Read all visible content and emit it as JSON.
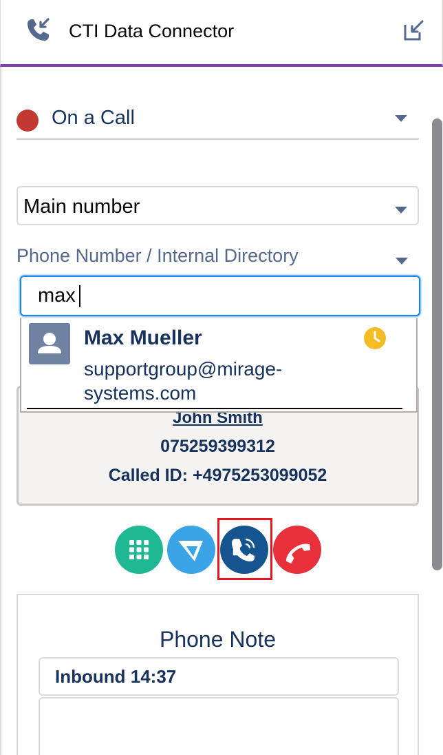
{
  "header": {
    "title": "CTI Data Connector",
    "icon": "phone-incoming-icon",
    "popout_icon": "popout-icon",
    "accent_color": "#7d3fb3"
  },
  "status": {
    "label": "On a Call",
    "color": "#c23934"
  },
  "line_select": {
    "value": "Main number"
  },
  "directory": {
    "label": "Phone Number / Internal Directory",
    "search_value": "max"
  },
  "search_result": {
    "name": "Max Mueller",
    "email": "supportgroup@mirage-systems.com",
    "presence_icon": "clock-icon",
    "presence_color": "#f4bc25"
  },
  "call": {
    "caller_name": "John Smith",
    "caller_number": "075259399312",
    "called_id": "Called ID: +4975253099052"
  },
  "actions": [
    {
      "name": "dialpad",
      "icon": "dialpad-icon",
      "color": "#1fb893"
    },
    {
      "name": "transfer",
      "icon": "transfer-icon",
      "color": "#3aa5e6"
    },
    {
      "name": "consult-call",
      "icon": "consult-call-icon",
      "color": "#16548f",
      "highlighted": true
    },
    {
      "name": "hang-up",
      "icon": "hang-up-icon",
      "color": "#e8303b"
    }
  ],
  "phone_note": {
    "title": "Phone Note",
    "subject": "Inbound 14:37",
    "body": ""
  }
}
